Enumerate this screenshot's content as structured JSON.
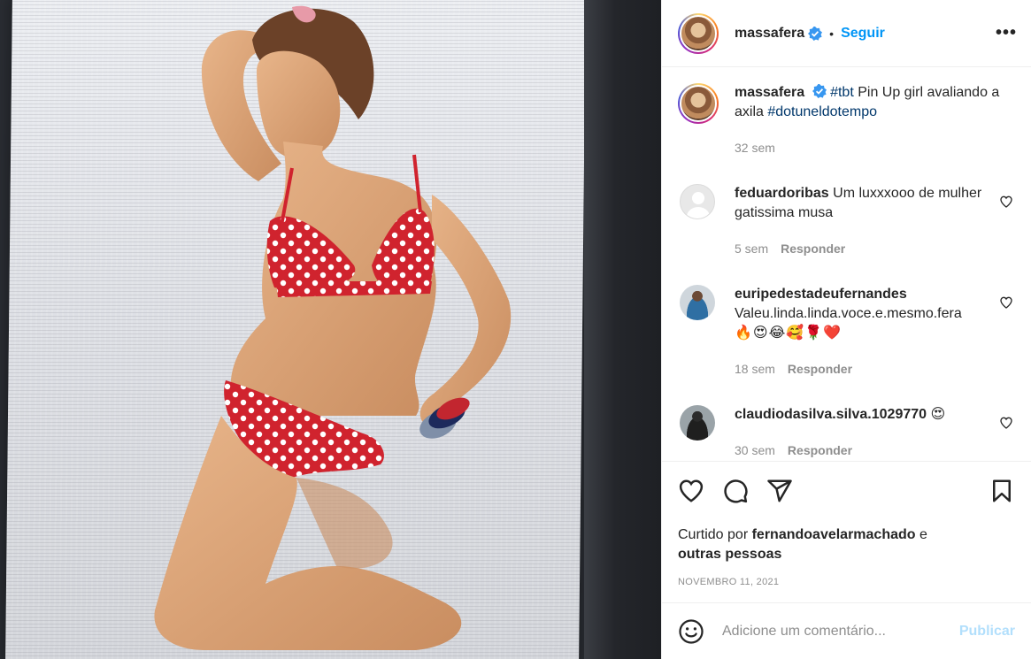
{
  "post": {
    "username": "massafera",
    "follow_label": "Seguir",
    "separator": "•",
    "more_label": "•••"
  },
  "caption": {
    "username": "massafera",
    "tag1": "#tbt",
    "text": " Pin Up girl avaliando a axila ",
    "tag2": "#dotuneldotempo",
    "time": "32 sem"
  },
  "comments": [
    {
      "username": "feduardoribas",
      "text": "Um luxxxooo de mulher gatissima musa",
      "emoji": "",
      "time": "5 sem",
      "reply": "Responder"
    },
    {
      "username": "euripedestadeufernandes",
      "text": "Valeu.linda.linda.voce.e.mesmo.fera",
      "emoji": "🔥😍😂🥰🌹❤️",
      "time": "18 sem",
      "reply": "Responder"
    },
    {
      "username": "claudiodasilva.silva.1029770",
      "text": "",
      "emoji": "😍",
      "time": "30 sem",
      "reply": "Responder"
    }
  ],
  "likes": {
    "prefix": "Curtido por ",
    "user": "fernandoavelarmachado",
    "middle": " e",
    "others": "outras pessoas"
  },
  "date": "NOVEMBRO 11, 2021",
  "composer": {
    "placeholder": "Adicione um comentário...",
    "publish_label": "Publicar"
  },
  "colors": {
    "accent": "#0095f6",
    "publish_disabled": "#b2dffc",
    "hashtag": "#00376b",
    "bikini": "#d0232e"
  },
  "icons": [
    "verified-badge-icon",
    "more-options-icon",
    "heart-icon",
    "comment-icon",
    "share-icon",
    "bookmark-icon",
    "emoji-icon"
  ]
}
